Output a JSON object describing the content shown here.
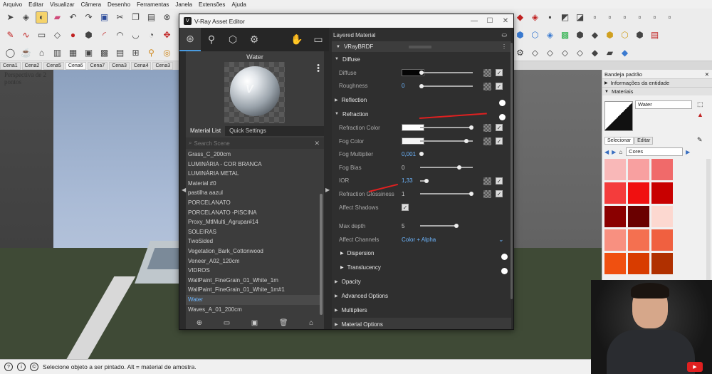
{
  "menubar": [
    "Arquivo",
    "Editar",
    "Visualizar",
    "Câmera",
    "Desenho",
    "Ferramentas",
    "Janela",
    "Extensões",
    "Ajuda"
  ],
  "scenes": {
    "tabs": [
      "Cena1",
      "Cena2",
      "Cena5",
      "Cena6",
      "Cena7",
      "Cena3",
      "Cena4",
      "Cena3"
    ],
    "active_index": 3
  },
  "viewport": {
    "label": "Perspectiva de 2 pontos"
  },
  "vray": {
    "window_title": "V-Ray Asset Editor",
    "preview_label": "Water",
    "subtabs": {
      "material_list": "Material List",
      "quick_settings": "Quick Settings"
    },
    "search_placeholder": "Search Scene",
    "materials": [
      "Grass_C_200cm",
      "LUMINÁRIA - COR BRANCA",
      "LUMINÁRIA METAL",
      "Material #0",
      "pastilha aazul",
      "PORCELANATO",
      "PORCELANATO -PISCINA",
      "Proxy_MtlMulti_Agrupar#14",
      "SOLEIRAS",
      "TwoSided",
      "Vegetation_Bark_Cottonwood",
      "Veneer_A02_120cm",
      "VIDROS",
      "WallPaint_FineGrain_01_White_1m",
      "WallPaint_FineGrain_01_White_1m#1",
      "Water",
      "Waves_A_01_200cm"
    ],
    "selected_material": "Water",
    "right": {
      "header": "Layered Material",
      "brdf": "VRayBRDF",
      "diffuse": {
        "title": "Diffuse",
        "diffuse_label": "Diffuse",
        "roughness_label": "Roughness",
        "roughness_value": "0"
      },
      "reflection": {
        "title": "Reflection",
        "on": true
      },
      "refraction": {
        "title": "Refraction",
        "on": true,
        "refraction_color_label": "Refraction Color",
        "fog_color_label": "Fog Color",
        "fog_multiplier_label": "Fog Multiplier",
        "fog_multiplier_value": "0,001",
        "fog_bias_label": "Fog Bias",
        "fog_bias_value": "0",
        "ior_label": "IOR",
        "ior_value": "1,33",
        "glossiness_label": "Refraction Glossiness",
        "glossiness_value": "1",
        "affect_shadows_label": "Affect Shadows",
        "max_depth_label": "Max depth",
        "max_depth_value": "5",
        "affect_channels_label": "Affect Channels",
        "affect_channels_value": "Color + Alpha"
      },
      "dispersion": {
        "title": "Dispersion",
        "on": false
      },
      "translucency": {
        "title": "Translucency",
        "on": false
      },
      "opacity": "Opacity",
      "advanced": "Advanced Options",
      "multipliers": "Multipliers",
      "material_options": "Material Options"
    }
  },
  "tray": {
    "title": "Bandeja padrão",
    "entity_info": "Informações da entidade",
    "materials": "Materiais",
    "material_name": "Water",
    "tab_select": "Selecionar",
    "tab_edit": "Editar",
    "library": "Cores",
    "swatches": [
      "#f9b8b8",
      "#f8a0a0",
      "#f06a6a",
      "#f43c3c",
      "#f01010",
      "#c80000",
      "#8a0000",
      "#6a0000",
      "#fcd8d0",
      "#f89080",
      "#f47050",
      "#f06040",
      "#f05010",
      "#d83c00",
      "#b03000"
    ]
  },
  "statusbar": {
    "message": "Selecione objeto a ser pintado. Alt = material de amostra."
  }
}
